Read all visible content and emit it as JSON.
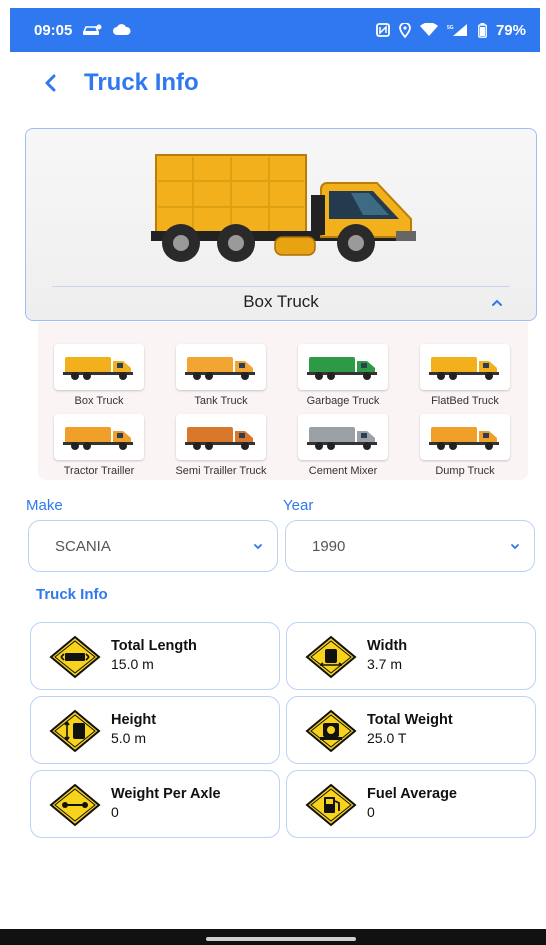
{
  "status_bar": {
    "time": "09:05",
    "battery": "79%"
  },
  "header": {
    "title": "Truck Info"
  },
  "selected_truck": {
    "name": "Box Truck"
  },
  "truck_types": [
    {
      "label": "Box Truck",
      "color": "#f2b01c"
    },
    {
      "label": "Tank Truck",
      "color": "#f2a533"
    },
    {
      "label": "Garbage Truck",
      "color": "#2e9a46"
    },
    {
      "label": "FlatBed Truck",
      "color": "#f2b01c"
    },
    {
      "label": "Tractor Trailler",
      "color": "#f0a028"
    },
    {
      "label": "Semi Trailler Truck",
      "color": "#d9772a"
    },
    {
      "label": "Cement Mixer",
      "color": "#9aa0a6"
    },
    {
      "label": "Dump Truck",
      "color": "#f0a028"
    }
  ],
  "make": {
    "label": "Make",
    "value": "SCANIA"
  },
  "year": {
    "label": "Year",
    "value": "1990"
  },
  "info_section": {
    "title": "Truck Info",
    "items": [
      {
        "title": "Total Length",
        "value": "15.0 m",
        "icon": "length-icon"
      },
      {
        "title": "Width",
        "value": "3.7 m",
        "icon": "width-icon"
      },
      {
        "title": "Height",
        "value": "5.0 m",
        "icon": "height-icon"
      },
      {
        "title": "Total Weight",
        "value": "25.0 T",
        "icon": "weight-icon"
      },
      {
        "title": "Weight Per Axle",
        "value": "0",
        "icon": "axle-icon"
      },
      {
        "title": "Fuel Average",
        "value": "0",
        "icon": "fuel-icon"
      }
    ]
  },
  "colors": {
    "accent": "#2f78f0",
    "sign": "#f7d31c",
    "truck_body": "#f2b01c"
  }
}
